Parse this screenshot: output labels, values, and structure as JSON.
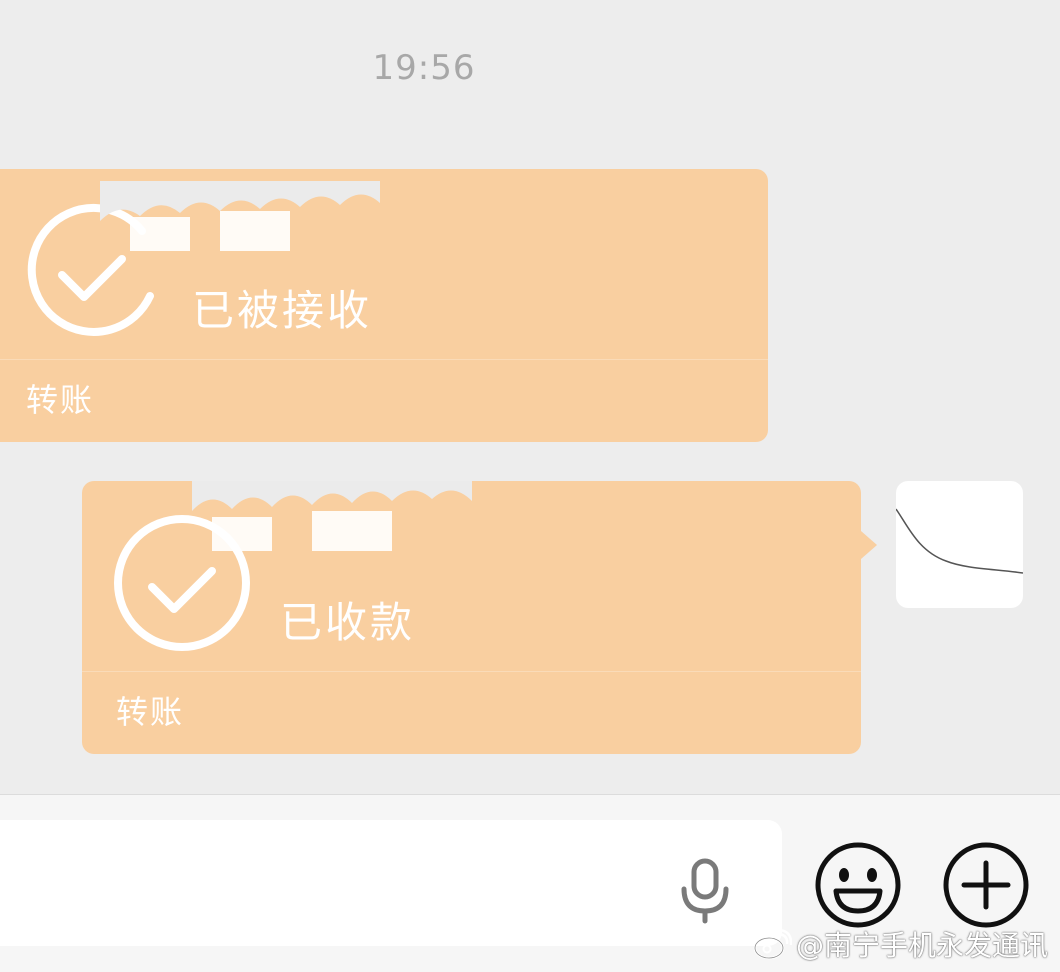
{
  "chat": {
    "timestamp": "19:56",
    "messages": [
      {
        "direction": "incoming",
        "status_text": "已被接收",
        "caption": "转账",
        "status_icon": "check-circle-icon"
      },
      {
        "direction": "outgoing",
        "status_text": "已收款",
        "caption": "转账",
        "status_icon": "check-circle-icon"
      }
    ]
  },
  "input_bar": {
    "mic_icon": "microphone-icon",
    "emoji_icon": "smiley-face-icon",
    "plus_icon": "plus-circle-icon"
  },
  "watermark": {
    "text": "@南宁手机永发通讯",
    "icon": "weibo-icon"
  },
  "colors": {
    "background": "#ededed",
    "transfer_bubble": "#f9cfa0",
    "timestamp": "#a8a8a8",
    "input_bar": "#f6f6f6"
  }
}
